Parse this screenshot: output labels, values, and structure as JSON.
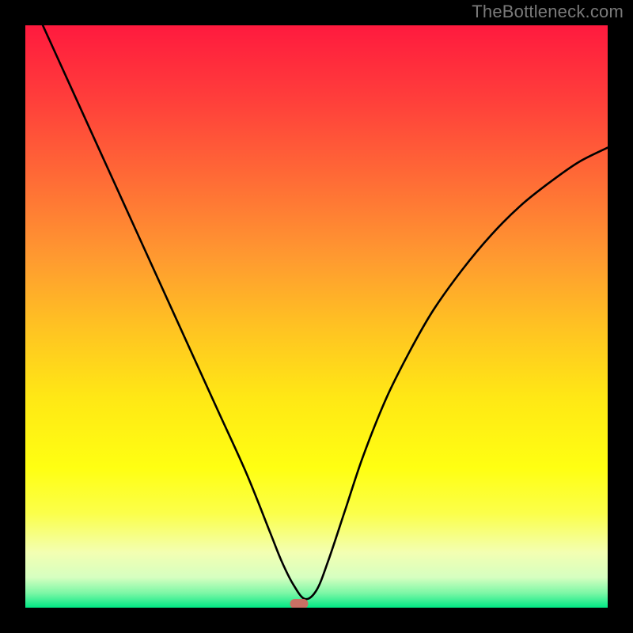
{
  "watermark": "TheBottleneck.com",
  "chart_data": {
    "type": "line",
    "title": "",
    "xlabel": "",
    "ylabel": "",
    "xlim": [
      0,
      100
    ],
    "ylim": [
      0,
      100
    ],
    "gradient_stops": [
      {
        "offset": 0.0,
        "color": "#ff1a3e"
      },
      {
        "offset": 0.12,
        "color": "#ff3c3b"
      },
      {
        "offset": 0.26,
        "color": "#ff6a36"
      },
      {
        "offset": 0.4,
        "color": "#ff9a30"
      },
      {
        "offset": 0.52,
        "color": "#ffc322"
      },
      {
        "offset": 0.64,
        "color": "#ffe815"
      },
      {
        "offset": 0.76,
        "color": "#ffff12"
      },
      {
        "offset": 0.838,
        "color": "#fbff4a"
      },
      {
        "offset": 0.905,
        "color": "#f3ffb2"
      },
      {
        "offset": 0.948,
        "color": "#d6ffc0"
      },
      {
        "offset": 0.975,
        "color": "#7cf7a6"
      },
      {
        "offset": 1.0,
        "color": "#00e884"
      }
    ],
    "series": [
      {
        "name": "bottleneck-curve",
        "x": [
          3.0,
          8.0,
          13.0,
          18.0,
          23.0,
          28.0,
          33.0,
          38.0,
          42.0,
          44.0,
          46.0,
          48.0,
          50.0,
          52.0,
          55.0,
          58.0,
          62.0,
          66.0,
          70.0,
          75.0,
          80.0,
          85.0,
          90.0,
          95.0,
          100.0
        ],
        "y": [
          100.0,
          89.0,
          78.0,
          67.0,
          56.0,
          45.0,
          34.0,
          23.0,
          13.0,
          8.0,
          4.0,
          1.5,
          3.0,
          8.0,
          17.0,
          26.0,
          36.0,
          44.0,
          51.0,
          58.0,
          64.0,
          69.0,
          73.0,
          76.5,
          79.0
        ]
      }
    ],
    "marker": {
      "x": 47.0,
      "y": 0.7,
      "color": "#c97064"
    },
    "colors": {
      "curve": "#000000",
      "frame_bg": "#000000",
      "watermark": "#7a7a7a"
    }
  }
}
